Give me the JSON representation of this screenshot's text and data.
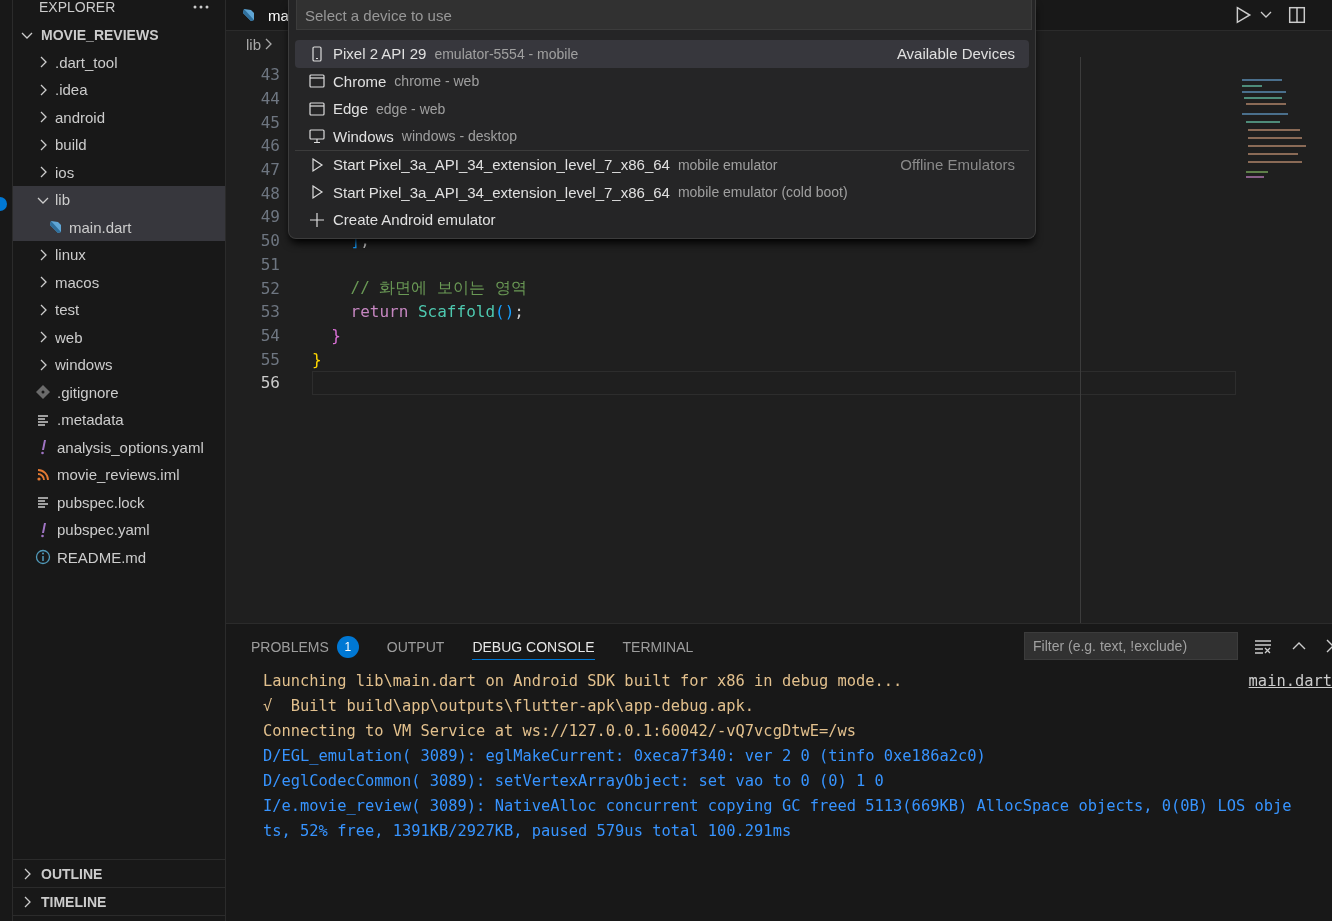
{
  "sidebar": {
    "title": "EXPLORER",
    "section": {
      "title": "MOVIE_REVIEWS",
      "expanded": true,
      "tree": [
        {
          "kind": "folder",
          "label": ".dart_tool",
          "expanded": false,
          "selected": false
        },
        {
          "kind": "folder",
          "label": ".idea",
          "expanded": false,
          "selected": false
        },
        {
          "kind": "folder",
          "label": "android",
          "expanded": false,
          "selected": false
        },
        {
          "kind": "folder",
          "label": "build",
          "expanded": false,
          "selected": false
        },
        {
          "kind": "folder",
          "label": "ios",
          "expanded": false,
          "selected": false
        },
        {
          "kind": "folder",
          "label": "lib",
          "expanded": true,
          "selected": true,
          "children": [
            {
              "kind": "dart-file",
              "label": "main.dart",
              "selected": true
            }
          ]
        },
        {
          "kind": "folder",
          "label": "linux",
          "expanded": false,
          "selected": false
        },
        {
          "kind": "folder",
          "label": "macos",
          "expanded": false,
          "selected": false
        },
        {
          "kind": "folder",
          "label": "test",
          "expanded": false,
          "selected": false
        },
        {
          "kind": "folder",
          "label": "web",
          "expanded": false,
          "selected": false
        },
        {
          "kind": "folder",
          "label": "windows",
          "expanded": false,
          "selected": false
        },
        {
          "kind": "git-file",
          "label": ".gitignore",
          "selected": false
        },
        {
          "kind": "text-file",
          "label": ".metadata",
          "selected": false
        },
        {
          "kind": "yaml-file",
          "label": "analysis_options.yaml",
          "selected": false
        },
        {
          "kind": "rss-file",
          "label": "movie_reviews.iml",
          "selected": false
        },
        {
          "kind": "text-file",
          "label": "pubspec.lock",
          "selected": false
        },
        {
          "kind": "yaml-file",
          "label": "pubspec.yaml",
          "selected": false
        },
        {
          "kind": "info-file",
          "label": "README.md",
          "selected": false
        }
      ]
    },
    "bottom_sections": [
      {
        "title": "OUTLINE",
        "expanded": false
      },
      {
        "title": "TIMELINE",
        "expanded": false
      }
    ]
  },
  "editor": {
    "tab": {
      "label": "ma"
    },
    "breadcrumb": [
      "lib"
    ],
    "lines": [
      {
        "number": "43",
        "current": false
      },
      {
        "number": "44",
        "current": false
      },
      {
        "number": "45",
        "current": false
      },
      {
        "number": "46",
        "current": false
      },
      {
        "number": "47",
        "current": false
      },
      {
        "number": "48",
        "current": false
      },
      {
        "number": "49",
        "current": false
      },
      {
        "number": "50",
        "current": false,
        "tokens": [
          {
            "kind": "bracket-blue",
            "text": "    ]"
          },
          {
            "kind": "plain",
            "text": ","
          }
        ]
      },
      {
        "number": "51",
        "current": false
      },
      {
        "number": "52",
        "current": false,
        "tokens": [
          {
            "kind": "comment",
            "text": "    // 화면에 보이는 영역"
          }
        ]
      },
      {
        "number": "53",
        "current": false,
        "tokens": [
          {
            "kind": "keyword",
            "text": "    return"
          },
          {
            "kind": "type",
            "text": " Scaffold"
          },
          {
            "kind": "bracket-blue",
            "text": "()"
          },
          {
            "kind": "plain",
            "text": ";"
          }
        ]
      },
      {
        "number": "54",
        "current": false,
        "tokens": [
          {
            "kind": "bracket-pink",
            "text": "  }"
          }
        ]
      },
      {
        "number": "55",
        "current": false,
        "tokens": [
          {
            "kind": "bracket-gold",
            "text": "}"
          }
        ]
      },
      {
        "number": "56",
        "current": true
      }
    ]
  },
  "quick_pick": {
    "placeholder": "Select a device to use",
    "groups": [
      {
        "label": "Available Devices",
        "items": [
          {
            "kind": "phone",
            "label": "Pixel 2 API 29",
            "description": "emulator-5554 - mobile",
            "selected": true
          },
          {
            "kind": "browser",
            "label": "Chrome",
            "description": "chrome - web",
            "selected": false
          },
          {
            "kind": "browser",
            "label": "Edge",
            "description": "edge - web",
            "selected": false
          },
          {
            "kind": "desktop",
            "label": "Windows",
            "description": "windows - desktop",
            "selected": false
          }
        ]
      },
      {
        "label": "Offline Emulators",
        "items": [
          {
            "kind": "play",
            "label": "Start Pixel_3a_API_34_extension_level_7_x86_64",
            "description": "mobile emulator",
            "selected": false
          },
          {
            "kind": "play",
            "label": "Start Pixel_3a_API_34_extension_level_7_x86_64",
            "description": "mobile emulator (cold boot)",
            "selected": false
          },
          {
            "kind": "plus",
            "label": "Create Android emulator",
            "selected": false
          }
        ]
      }
    ]
  },
  "panel": {
    "tabs": [
      {
        "label": "PROBLEMS",
        "badge": "1",
        "selected": false
      },
      {
        "label": "OUTPUT",
        "selected": false
      },
      {
        "label": "DEBUG CONSOLE",
        "selected": true
      },
      {
        "label": "TERMINAL",
        "selected": false
      }
    ],
    "filter": {
      "placeholder": "Filter (e.g. text, !exclude)"
    },
    "console": [
      {
        "kind": "status",
        "text": "Launching lib\\main.dart on Android SDK built for x86 in debug mode...",
        "source": "main.dart"
      },
      {
        "kind": "status",
        "text": "√  Built build\\app\\outputs\\flutter-apk\\app-debug.apk."
      },
      {
        "kind": "status",
        "text": "Connecting to VM Service at ws://127.0.0.1:60042/-vQ7vcgDtwE=/ws"
      },
      {
        "kind": "log",
        "text": "D/EGL_emulation( 3089): eglMakeCurrent: 0xeca7f340: ver 2 0 (tinfo 0xe186a2c0)"
      },
      {
        "kind": "log",
        "text": "D/eglCodecCommon( 3089): setVertexArrayObject: set vao to 0 (0) 1 0"
      },
      {
        "kind": "log",
        "text": "I/e.movie_review( 3089): NativeAlloc concurrent copying GC freed 5113(669KB) AllocSpace objects, 0(0B) LOS obje"
      },
      {
        "kind": "log",
        "text": "ts, 52% free, 1391KB/2927KB, paused 579us total 100.291ms"
      }
    ]
  }
}
